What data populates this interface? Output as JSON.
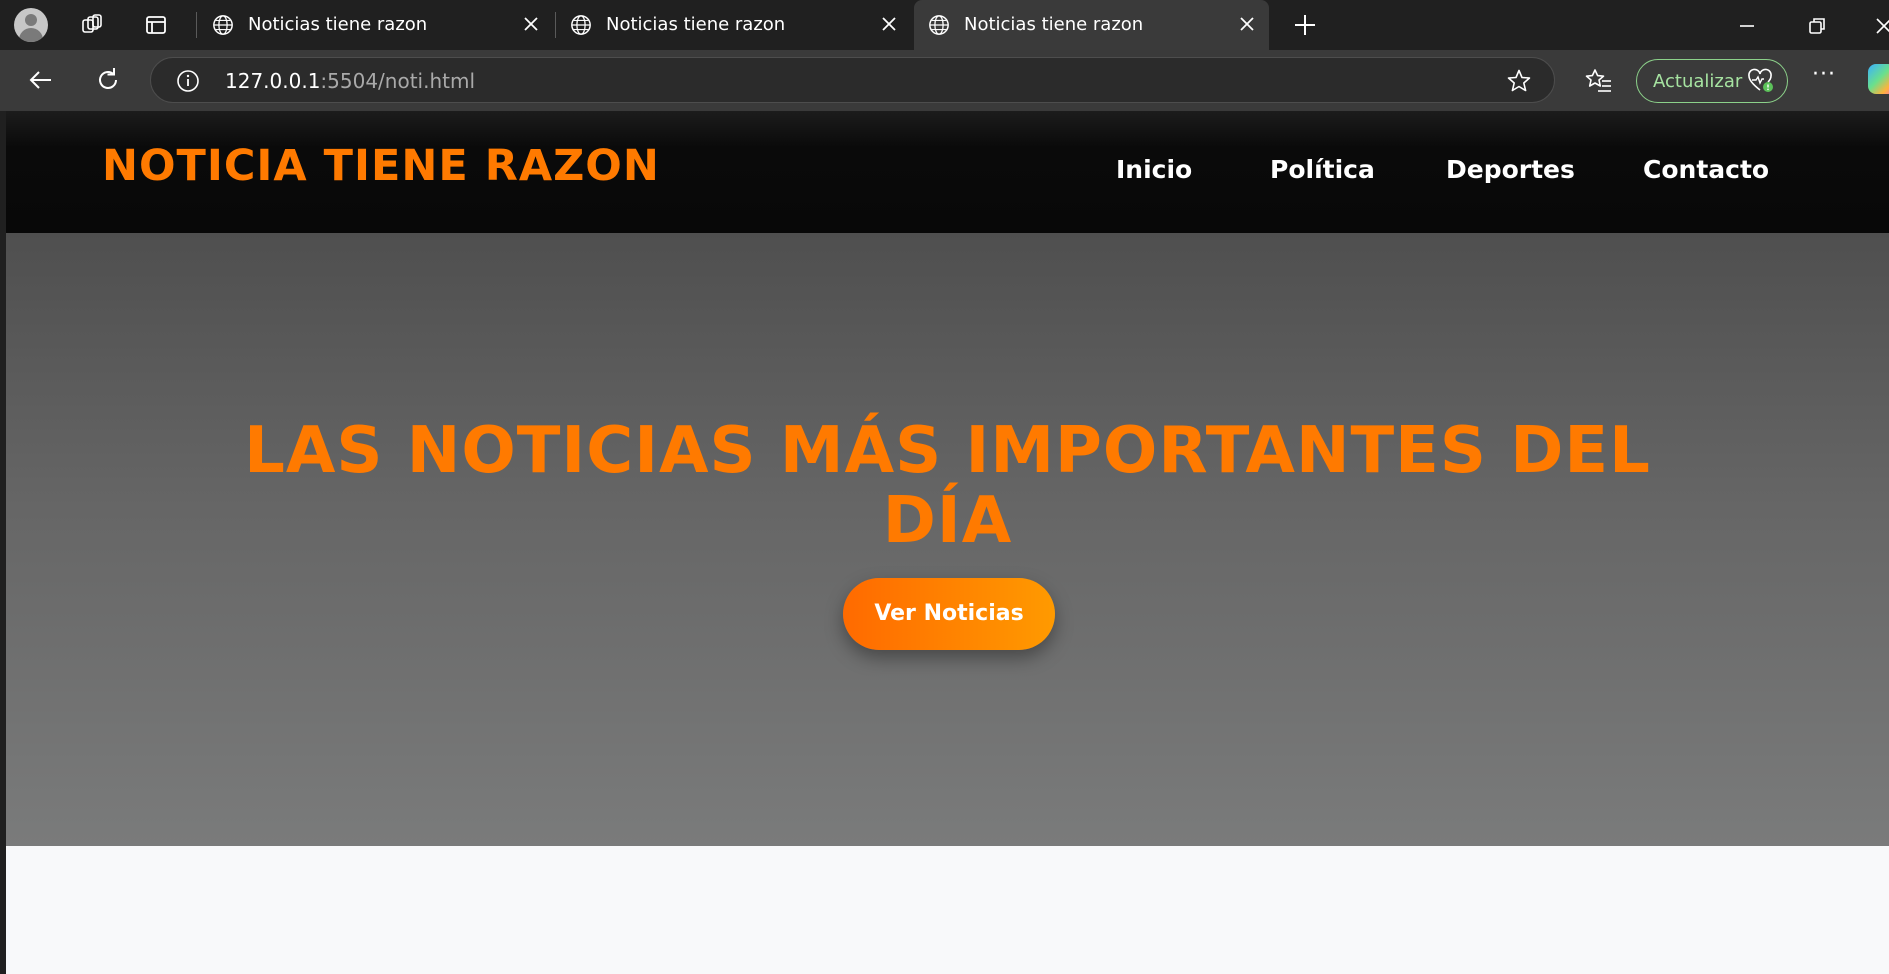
{
  "browser": {
    "tabs": [
      {
        "title": "Noticias tiene razon",
        "active": false
      },
      {
        "title": "Noticias tiene razon",
        "active": false
      },
      {
        "title": "Noticias tiene razon",
        "active": true
      }
    ],
    "address": {
      "host": "127.0.0.1",
      "rest": ":5504/noti.html"
    },
    "update_label": "Actualizar",
    "more_label": "···",
    "colors": {
      "tabstrip": "#202020",
      "toolbar": "#3a3a3a",
      "update_border": "#8cd18a"
    }
  },
  "site": {
    "brand": "NOTICIA TIENE RAZON",
    "nav": [
      "Inicio",
      "Política",
      "Deportes",
      "Contacto"
    ],
    "hero": {
      "title_line1": "LAS NOTICIAS MÁS IMPORTANTES DEL",
      "title_line2": "DÍA",
      "cta_label": "Ver Noticias"
    },
    "colors": {
      "accent": "#ff7a00",
      "header_bg": "#0a0a0a",
      "hero_bg": "#666666",
      "page_bg": "#f8f9fa"
    }
  }
}
